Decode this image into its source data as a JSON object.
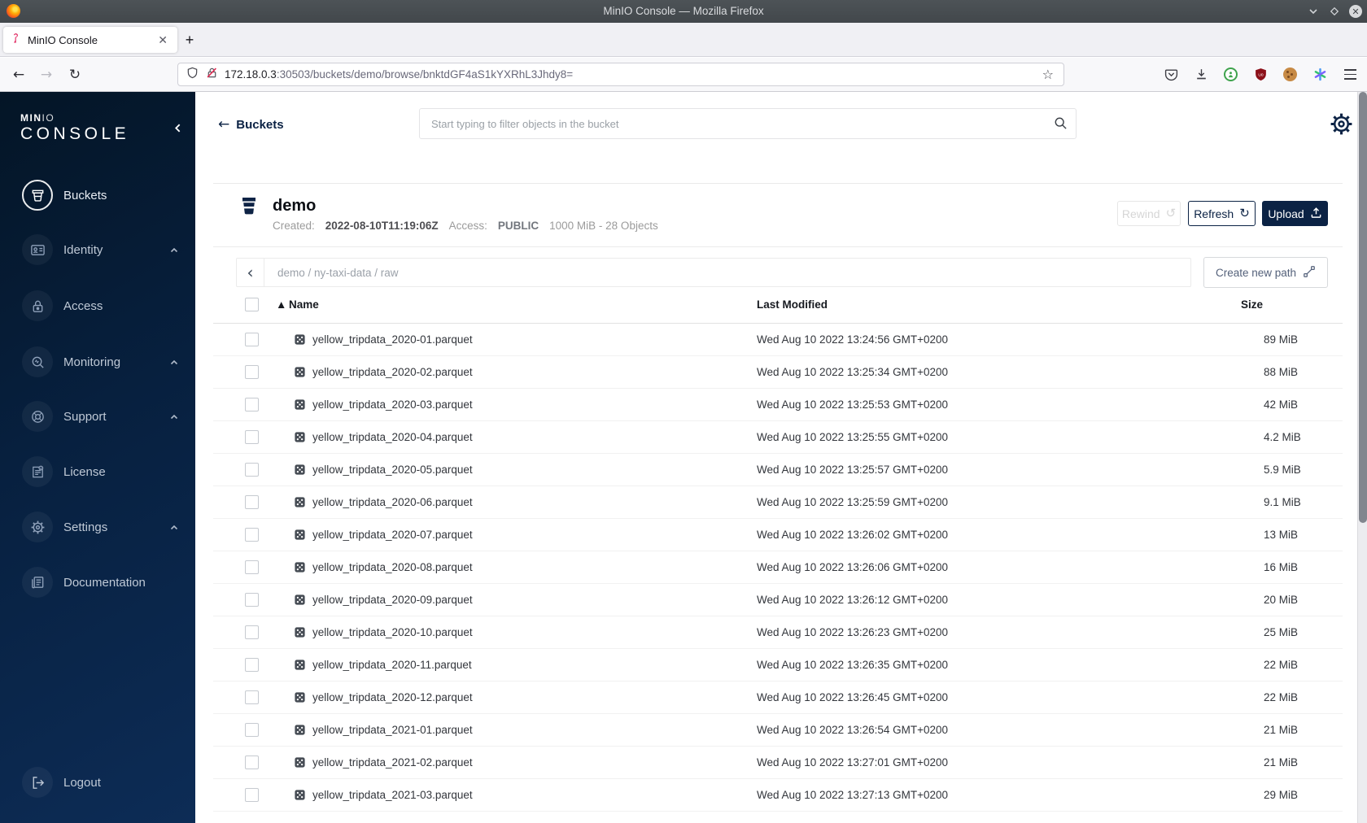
{
  "window": {
    "title": "MinIO Console — Mozilla Firefox"
  },
  "browser": {
    "tab_title": "MinIO Console",
    "url_host": "172.18.0.3",
    "url_rest": ":30503/buckets/demo/browse/bnktdGF4aS1kYXRhL3Jhdy8="
  },
  "sidebar": {
    "logo_min": "MIN",
    "logo_io": "IO",
    "logo_console": "CONSOLE",
    "items": [
      {
        "label": "Buckets",
        "selected": true,
        "has_caret": false
      },
      {
        "label": "Identity",
        "selected": false,
        "has_caret": true
      },
      {
        "label": "Access",
        "selected": false,
        "has_caret": false
      },
      {
        "label": "Monitoring",
        "selected": false,
        "has_caret": true
      },
      {
        "label": "Support",
        "selected": false,
        "has_caret": true
      },
      {
        "label": "License",
        "selected": false,
        "has_caret": false
      },
      {
        "label": "Settings",
        "selected": false,
        "has_caret": true
      },
      {
        "label": "Documentation",
        "selected": false,
        "has_caret": false
      }
    ],
    "logout_label": "Logout"
  },
  "header": {
    "back_label": "Buckets",
    "search_placeholder": "Start typing to filter objects in the bucket"
  },
  "bucket": {
    "name": "demo",
    "created_label": "Created:",
    "created": "2022-08-10T11:19:06Z",
    "access_label": "Access:",
    "access": "PUBLIC",
    "usage": "1000 MiB - 28 Objects",
    "rewind_label": "Rewind",
    "refresh_label": "Refresh",
    "upload_label": "Upload",
    "rewind_icon": "↺",
    "refresh_icon": "↻"
  },
  "browse": {
    "breadcrumb": "demo / ny-taxi-data / raw",
    "create_path_label": "Create new path"
  },
  "table": {
    "headers": {
      "name": "Name",
      "last_modified": "Last Modified",
      "size": "Size",
      "sort_icon": "▲"
    },
    "rows": [
      {
        "name": "yellow_tripdata_2020-01.parquet",
        "modified": "Wed Aug 10 2022 13:24:56 GMT+0200",
        "size": "89 MiB"
      },
      {
        "name": "yellow_tripdata_2020-02.parquet",
        "modified": "Wed Aug 10 2022 13:25:34 GMT+0200",
        "size": "88 MiB"
      },
      {
        "name": "yellow_tripdata_2020-03.parquet",
        "modified": "Wed Aug 10 2022 13:25:53 GMT+0200",
        "size": "42 MiB"
      },
      {
        "name": "yellow_tripdata_2020-04.parquet",
        "modified": "Wed Aug 10 2022 13:25:55 GMT+0200",
        "size": "4.2 MiB"
      },
      {
        "name": "yellow_tripdata_2020-05.parquet",
        "modified": "Wed Aug 10 2022 13:25:57 GMT+0200",
        "size": "5.9 MiB"
      },
      {
        "name": "yellow_tripdata_2020-06.parquet",
        "modified": "Wed Aug 10 2022 13:25:59 GMT+0200",
        "size": "9.1 MiB"
      },
      {
        "name": "yellow_tripdata_2020-07.parquet",
        "modified": "Wed Aug 10 2022 13:26:02 GMT+0200",
        "size": "13 MiB"
      },
      {
        "name": "yellow_tripdata_2020-08.parquet",
        "modified": "Wed Aug 10 2022 13:26:06 GMT+0200",
        "size": "16 MiB"
      },
      {
        "name": "yellow_tripdata_2020-09.parquet",
        "modified": "Wed Aug 10 2022 13:26:12 GMT+0200",
        "size": "20 MiB"
      },
      {
        "name": "yellow_tripdata_2020-10.parquet",
        "modified": "Wed Aug 10 2022 13:26:23 GMT+0200",
        "size": "25 MiB"
      },
      {
        "name": "yellow_tripdata_2020-11.parquet",
        "modified": "Wed Aug 10 2022 13:26:35 GMT+0200",
        "size": "22 MiB"
      },
      {
        "name": "yellow_tripdata_2020-12.parquet",
        "modified": "Wed Aug 10 2022 13:26:45 GMT+0200",
        "size": "22 MiB"
      },
      {
        "name": "yellow_tripdata_2021-01.parquet",
        "modified": "Wed Aug 10 2022 13:26:54 GMT+0200",
        "size": "21 MiB"
      },
      {
        "name": "yellow_tripdata_2021-02.parquet",
        "modified": "Wed Aug 10 2022 13:27:01 GMT+0200",
        "size": "21 MiB"
      },
      {
        "name": "yellow_tripdata_2021-03.parquet",
        "modified": "Wed Aug 10 2022 13:27:13 GMT+0200",
        "size": "29 MiB"
      }
    ]
  }
}
